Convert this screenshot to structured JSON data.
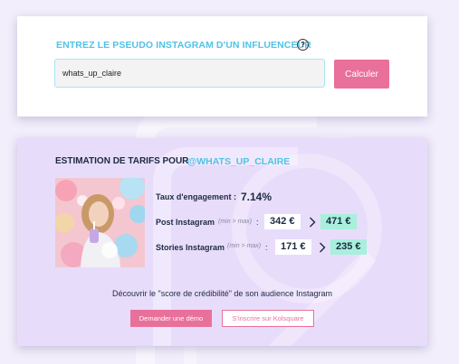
{
  "search": {
    "label": "ENTREZ LE PSEUDO INSTAGRAM D'UN INFLUENCEUR",
    "help_icon": "question-circle-icon",
    "input_value": "whats_up_claire",
    "button_label": "Calculer"
  },
  "estimation": {
    "title": "ESTIMATION DE TARIFS POUR",
    "handle": "@WHATS_UP_CLAIRE",
    "engagement": {
      "label": "Taux d'engagement :",
      "value": "7.14%"
    },
    "post": {
      "label": "Post Instagram",
      "range_hint": "(min > max)",
      "colon": ":",
      "min": "342 €",
      "max": "471 €"
    },
    "stories": {
      "label": "Stories Instagram",
      "range_hint": "(min > max)",
      "colon": ":",
      "min": "171 €",
      "max": "235 €"
    },
    "credibility_text": "Découvrir le \"score de crédibilité\" de son audience Instagram",
    "demo_button": "Demander une démo",
    "signup_button": "S'inscrire sur Kolsquare"
  },
  "colors": {
    "accent_blue": "#4fc3e6",
    "accent_pink": "#e9709a",
    "max_price_bg": "#a8f0dc",
    "result_bg": "#e8dcfb",
    "page_bg": "#f2eefb"
  }
}
